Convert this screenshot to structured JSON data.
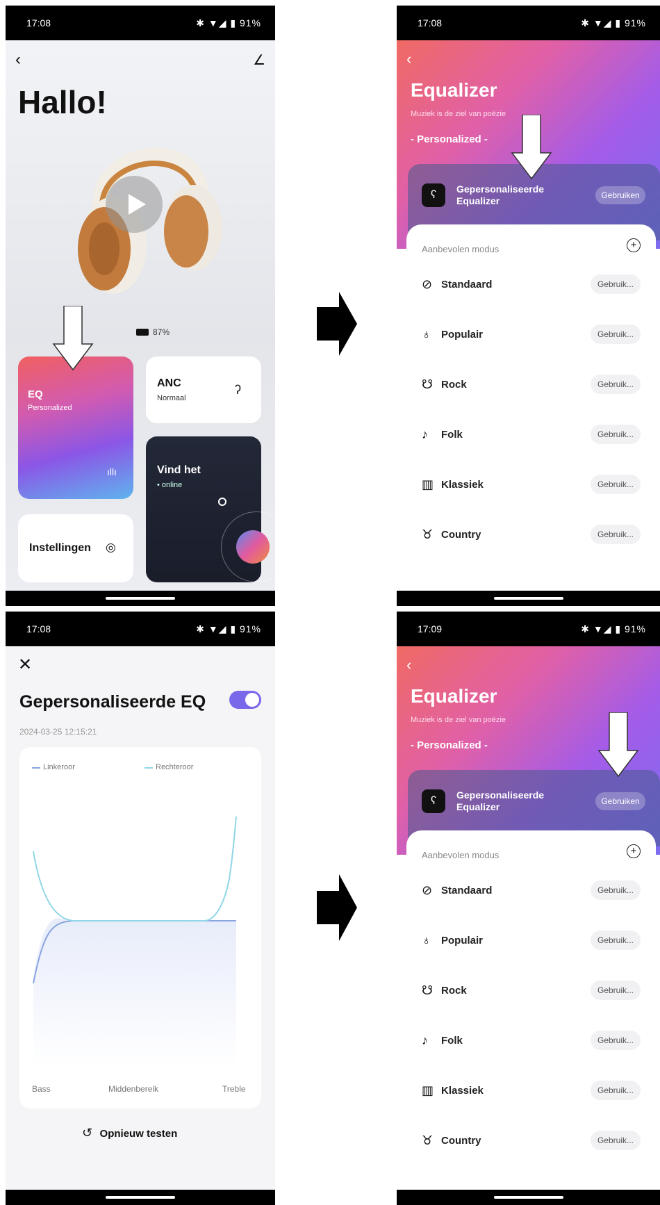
{
  "status": {
    "time1": "17:08",
    "time2": "17:08",
    "time3": "17:08",
    "time4": "17:09",
    "icons": "✱ ▼◢ ▮ 91%"
  },
  "home": {
    "greeting": "Hallo!",
    "battery": "87%",
    "eq_title": "EQ",
    "eq_sub": "Personalized",
    "anc_title": "ANC",
    "anc_sub": "Normaal",
    "find_title": "Vind het",
    "find_sub": "• online",
    "settings": "Instellingen"
  },
  "equalizer": {
    "title": "Equalizer",
    "subtitle": "Muziek is de ziel van poëzie",
    "section": "- Personalized -",
    "personal_label": "Gepersonaliseerde Equalizer",
    "use_btn": "Gebruiken",
    "recommended": "Aanbevolen modus",
    "modes": [
      {
        "label": "Standaard",
        "icon": "⊘",
        "btn": "Gebruik..."
      },
      {
        "label": "Populair",
        "icon": "♁",
        "btn": "Gebruik..."
      },
      {
        "label": "Rock",
        "icon": "☋",
        "btn": "Gebruik..."
      },
      {
        "label": "Folk",
        "icon": "♪",
        "btn": "Gebruik..."
      },
      {
        "label": "Klassiek",
        "icon": "▥",
        "btn": "Gebruik..."
      },
      {
        "label": "Country",
        "icon": "♉",
        "btn": "Gebruik..."
      }
    ]
  },
  "personal_eq": {
    "title": "Gepersonaliseerde EQ",
    "date": "2024-03-25 12:15:21",
    "legend_left": "Linkeroor",
    "legend_right": "Rechteroor",
    "x_bass": "Bass",
    "x_mid": "Middenbereik",
    "x_treble": "Treble",
    "retest": "Opnieuw testen",
    "left_color": "#8aa4e0",
    "right_color": "#8fd6e6"
  }
}
